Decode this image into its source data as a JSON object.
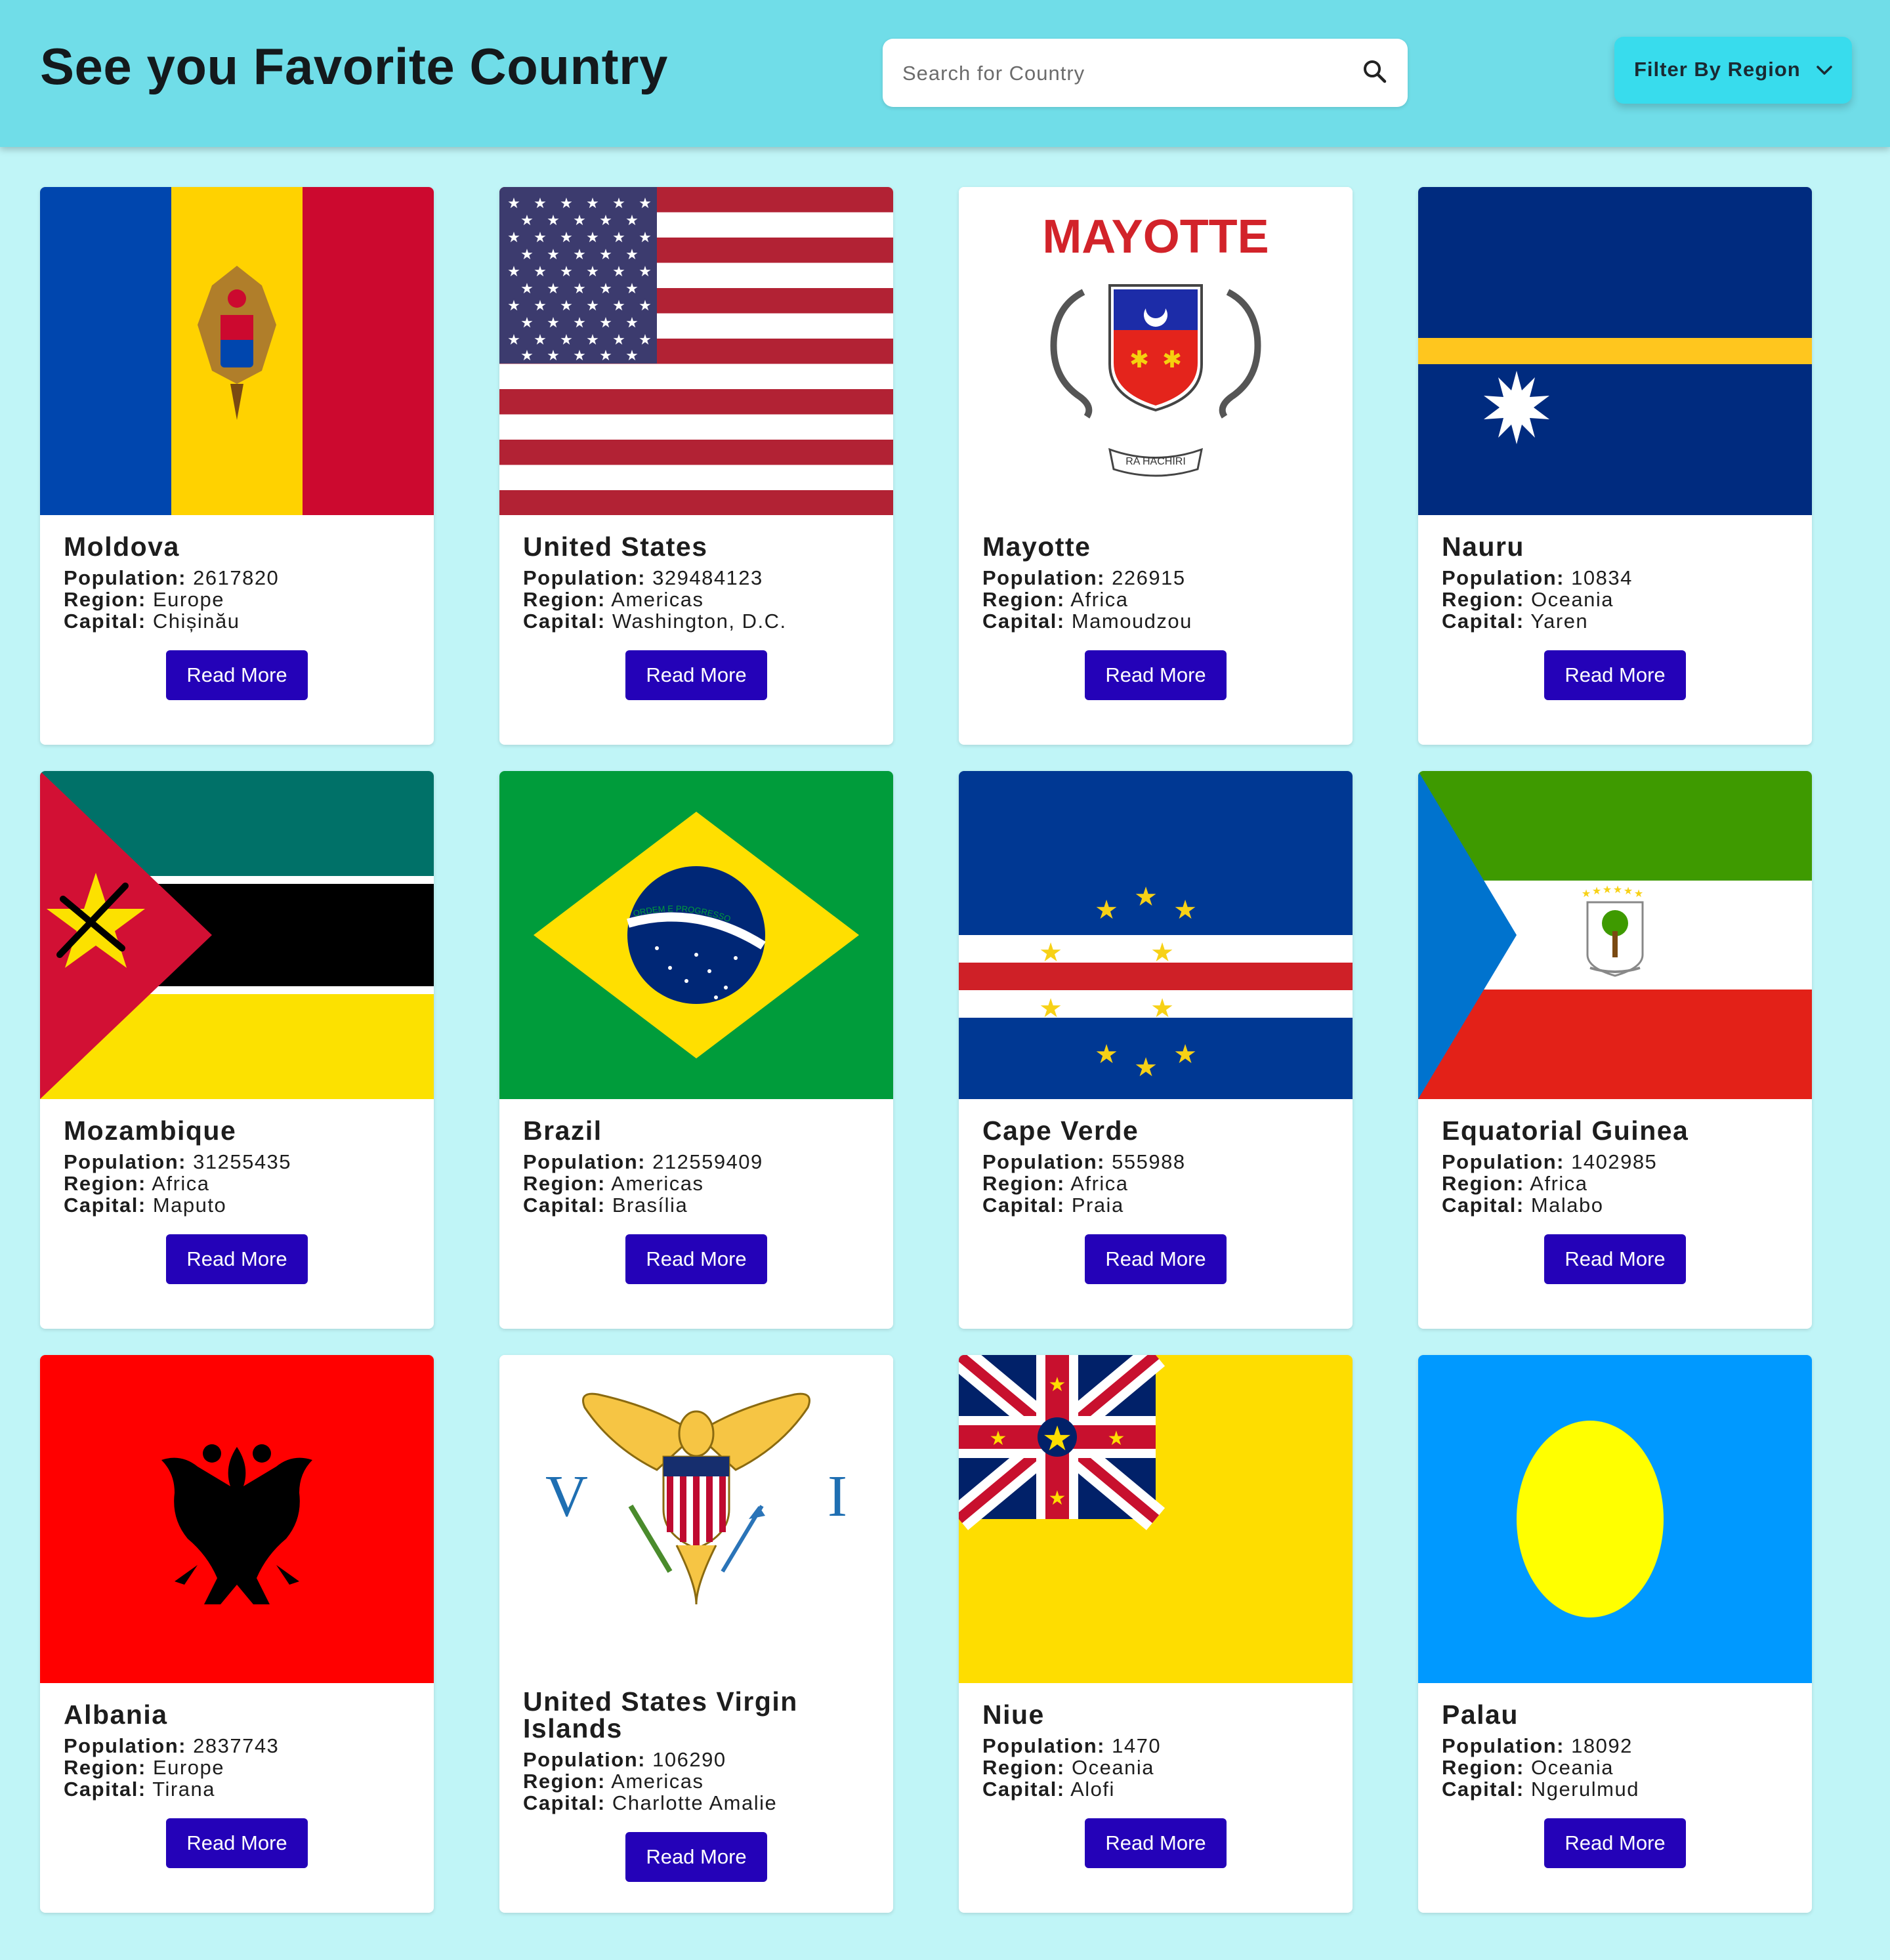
{
  "header": {
    "title": "See you Favorite Country",
    "search_placeholder": "Search for Country",
    "filter_label": "Filter By Region"
  },
  "labels": {
    "population": "Population:",
    "region": "Region:",
    "capital": "Capital:",
    "read_more": "Read More"
  },
  "countries": [
    {
      "name": "Moldova",
      "population": "2617820",
      "region": "Europe",
      "capital": "Chișinău",
      "flag": "moldova-flag"
    },
    {
      "name": "United States",
      "population": "329484123",
      "region": "Americas",
      "capital": "Washington, D.C.",
      "flag": "united-states-flag"
    },
    {
      "name": "Mayotte",
      "population": "226915",
      "region": "Africa",
      "capital": "Mamoudzou",
      "flag": "mayotte-flag",
      "flag_text": "MAYOTTE",
      "motto": "RA HACHIRI"
    },
    {
      "name": "Nauru",
      "population": "10834",
      "region": "Oceania",
      "capital": "Yaren",
      "flag": "nauru-flag"
    },
    {
      "name": "Mozambique",
      "population": "31255435",
      "region": "Africa",
      "capital": "Maputo",
      "flag": "mozambique-flag"
    },
    {
      "name": "Brazil",
      "population": "212559409",
      "region": "Americas",
      "capital": "Brasília",
      "flag": "brazil-flag",
      "motto": "ORDEM E PROGRESSO"
    },
    {
      "name": "Cape Verde",
      "population": "555988",
      "region": "Africa",
      "capital": "Praia",
      "flag": "cape-verde-flag"
    },
    {
      "name": "Equatorial Guinea",
      "population": "1402985",
      "region": "Africa",
      "capital": "Malabo",
      "flag": "equatorial-guinea-flag"
    },
    {
      "name": "Albania",
      "population": "2837743",
      "region": "Europe",
      "capital": "Tirana",
      "flag": "albania-flag"
    },
    {
      "name": "United States Virgin Islands",
      "population": "106290",
      "region": "Americas",
      "capital": "Charlotte Amalie",
      "flag": "us-virgin-islands-flag",
      "letters": [
        "V",
        "I"
      ]
    },
    {
      "name": "Niue",
      "population": "1470",
      "region": "Oceania",
      "capital": "Alofi",
      "flag": "niue-flag"
    },
    {
      "name": "Palau",
      "population": "18092",
      "region": "Oceania",
      "capital": "Ngerulmud",
      "flag": "palau-flag"
    }
  ],
  "colors": {
    "header_bg": "#70dde8",
    "page_bg": "#c0f5f7",
    "filter_bg": "#38dced",
    "button_bg": "#2402b8"
  }
}
